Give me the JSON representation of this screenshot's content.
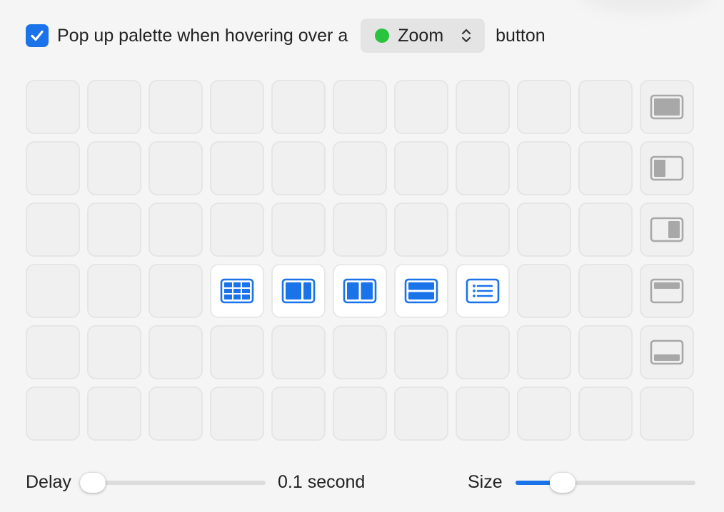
{
  "settings": {
    "popup_checkbox": {
      "checked": true
    },
    "label_before": "Pop up palette when hovering over a",
    "trigger_button": {
      "value": "Zoom",
      "dot_color": "#2ac33f"
    },
    "label_after": "button"
  },
  "palette": {
    "rows": 6,
    "columns": 11,
    "active_cells": [
      {
        "row": 4,
        "column": 4,
        "icon": "grid-layout-icon"
      },
      {
        "row": 4,
        "column": 5,
        "icon": "left-major-split-icon"
      },
      {
        "row": 4,
        "column": 6,
        "icon": "left-right-split-icon"
      },
      {
        "row": 4,
        "column": 7,
        "icon": "top-bottom-split-icon"
      },
      {
        "row": 4,
        "column": 8,
        "icon": "list-layout-icon"
      }
    ],
    "side_column_icons": [
      "fill-screen-icon",
      "left-half-icon",
      "right-half-icon",
      "top-half-icon",
      "bottom-half-icon"
    ]
  },
  "delay": {
    "label": "Delay",
    "value_text": "0.1 second",
    "level": 0.04
  },
  "size": {
    "label": "Size",
    "level": 0.26
  },
  "colors": {
    "accent": "#1a73e8",
    "gray_icon": "#a8a8a8"
  }
}
